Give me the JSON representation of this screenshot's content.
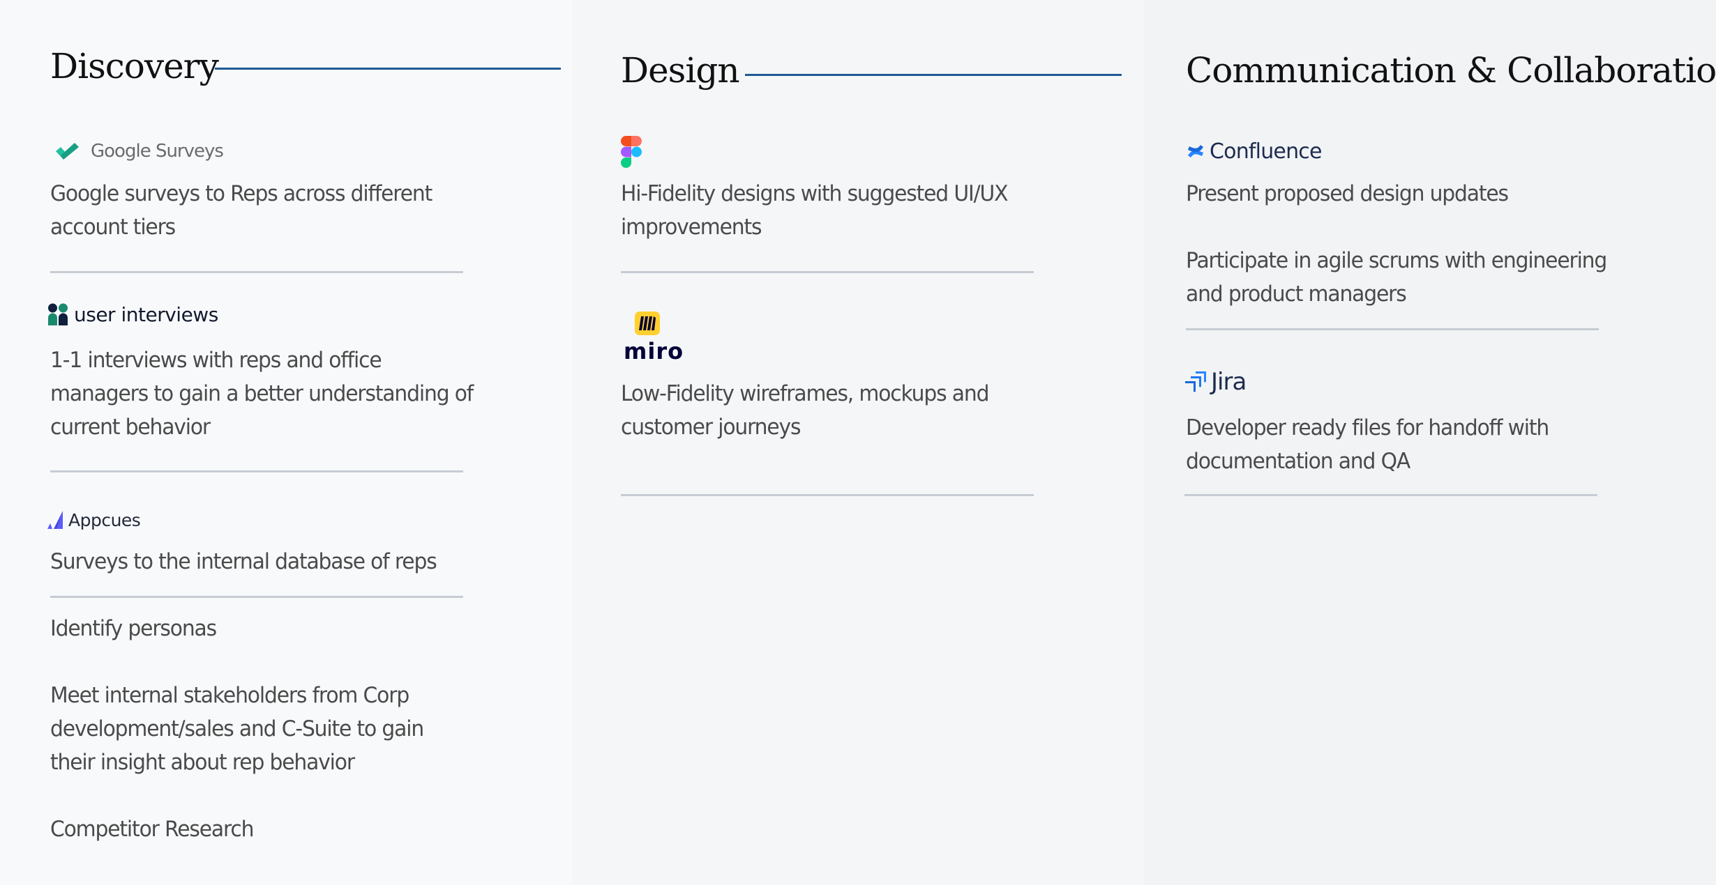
{
  "columns": [
    {
      "title": "Discovery",
      "tools": [
        {
          "logo": "google-surveys-logo",
          "logo_text": "Google Surveys",
          "icon": "checkmark-icon",
          "items": [
            "Google surveys to Reps across different account tiers"
          ]
        },
        {
          "logo": "user-interviews-logo",
          "logo_text": "user interviews",
          "icon": "people-icon",
          "items": [
            "1-1 interviews with reps and office managers to gain a better understanding of current behavior"
          ]
        },
        {
          "logo": "appcues-logo",
          "logo_text": "Appcues",
          "icon": "appcues-icon",
          "items": [
            "Surveys to the internal database of reps"
          ]
        }
      ],
      "extra_items": [
        "Identify personas",
        "Meet internal stakeholders from Corp development/sales and C-Suite to gain their insight about rep behavior",
        "Competitor Research"
      ]
    },
    {
      "title": "Design",
      "tools": [
        {
          "logo": "figma-logo",
          "logo_text": "",
          "icon": "figma-icon",
          "items": [
            "Hi-Fidelity designs with suggested UI/UX improvements"
          ]
        },
        {
          "logo": "miro-logo",
          "logo_text": "miro",
          "icon": "miro-icon",
          "items": [
            "Low-Fidelity wireframes, mockups and customer journeys"
          ]
        }
      ]
    },
    {
      "title": "Communication & Collaboration",
      "tools": [
        {
          "logo": "confluence-logo",
          "logo_text": "Confluence",
          "icon": "confluence-icon",
          "items": [
            "Present proposed design updates",
            "Participate in agile scrums with engineering and product managers"
          ]
        },
        {
          "logo": "jira-logo",
          "logo_text": "Jira",
          "icon": "jira-icon",
          "items": [
            "Developer ready files for handoff with documentation and QA"
          ]
        }
      ]
    }
  ],
  "colors": {
    "heading_rule": "#1f5a94",
    "body_text": "#4a4a4a",
    "divider": "#c6ccd3"
  }
}
